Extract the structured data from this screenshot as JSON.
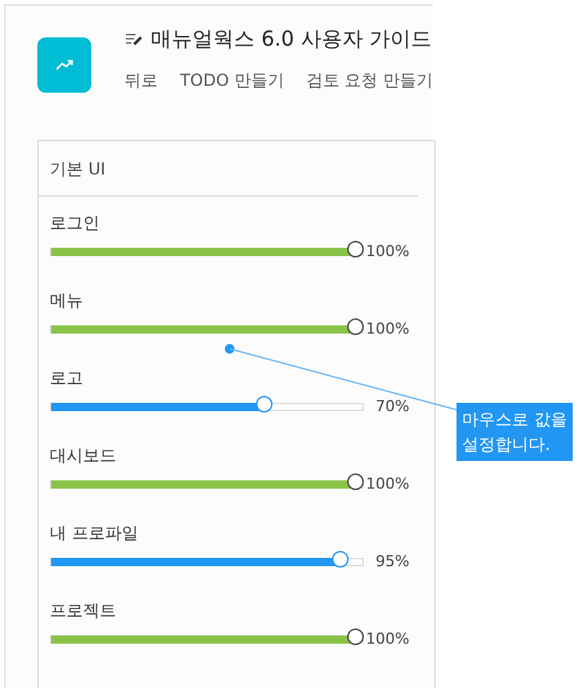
{
  "header": {
    "title": "매뉴얼웍스 6.0 사용자 가이드",
    "links": [
      "뒤로",
      "TODO 만들기",
      "검토 요청 만들기"
    ]
  },
  "card": {
    "title": "기본 UI",
    "items": [
      {
        "label": "로그인",
        "level": 1,
        "reading": "100%"
      },
      {
        "label": "메뉴",
        "level": 1,
        "reading": "100%"
      },
      {
        "label": "로고",
        "level": 0.7,
        "reading": "70%"
      },
      {
        "label": "대시보드",
        "level": 1,
        "reading": "100%"
      },
      {
        "label": "내 프로파일",
        "level": 0.95,
        "reading": "95%"
      },
      {
        "label": "프로젝트",
        "level": 1,
        "reading": "100%"
      }
    ]
  },
  "callout": {
    "text": "마우스로 값을 설정합니다."
  }
}
